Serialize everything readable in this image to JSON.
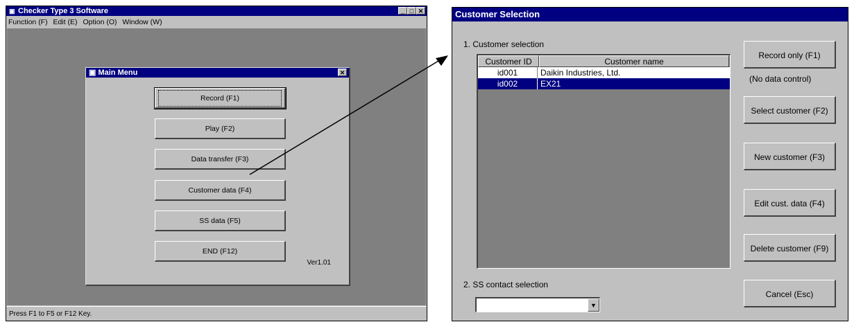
{
  "app": {
    "title": "Checker Type 3 Software",
    "menus": [
      "Function (F)",
      "Edit (E)",
      "Option (O)",
      "Window (W)"
    ],
    "status": "Press F1 to F5 or F12 Key.",
    "window_buttons": [
      "_",
      "□",
      "✕"
    ]
  },
  "main_menu": {
    "title": "Main Menu",
    "close": "✕",
    "buttons": [
      "Record (F1)",
      "Play (F2)",
      "Data transfer (F3)",
      "Customer data (F4)",
      "SS data (F5)",
      "END (F12)"
    ],
    "version": "Ver1.01"
  },
  "customer_selection": {
    "title": "Customer Selection",
    "section1_label": "1. Customer selection",
    "columns": [
      "Customer ID",
      "Customer name"
    ],
    "rows": [
      {
        "id": "id001",
        "name": "Daikin Industries, Ltd."
      },
      {
        "id": "id002",
        "name": "EX21"
      }
    ],
    "selected_row": "id002",
    "no_data_control": "(No data control)",
    "buttons": [
      "Record only (F1)",
      "Select customer (F2)",
      "New customer (F3)",
      "Edit cust. data (F4)",
      "Delete customer (F9)",
      "Cancel (Esc)"
    ],
    "section2_label": "2. SS contact selection",
    "ss_contact_value": "",
    "dropdown_arrow": "▼"
  }
}
